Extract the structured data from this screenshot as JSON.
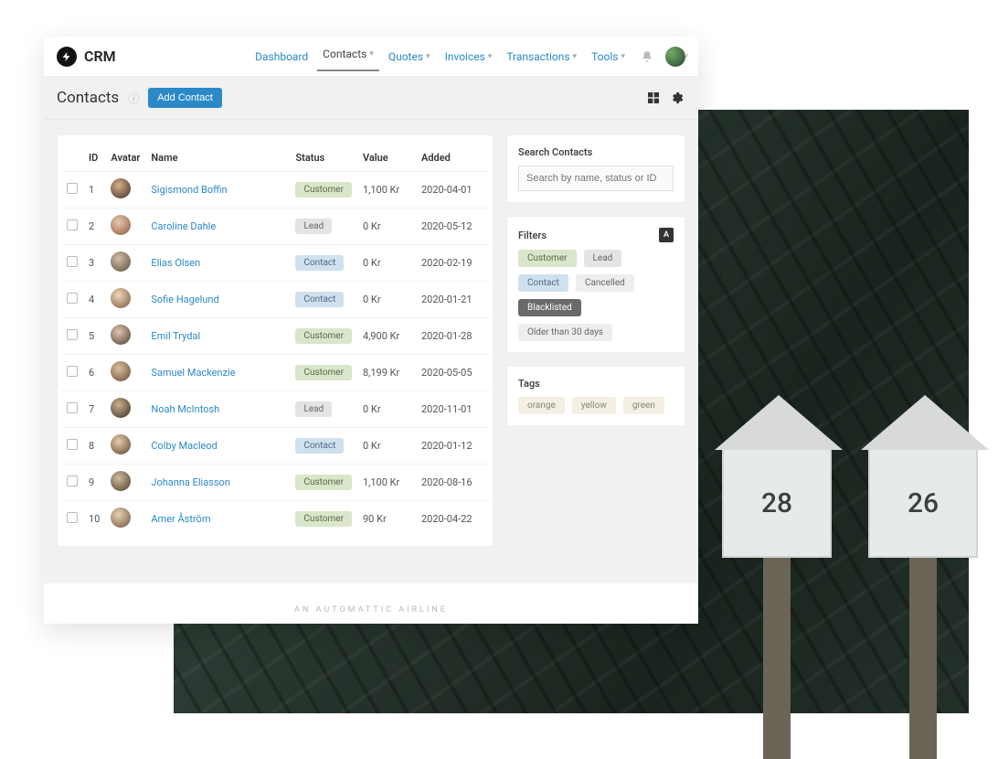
{
  "brand": {
    "name": "CRM"
  },
  "nav": {
    "items": [
      {
        "label": "Dashboard"
      },
      {
        "label": "Contacts",
        "active": true
      },
      {
        "label": "Quotes"
      },
      {
        "label": "Invoices"
      },
      {
        "label": "Transactions"
      },
      {
        "label": "Tools"
      }
    ]
  },
  "page": {
    "title": "Contacts",
    "add_button": "Add Contact"
  },
  "table": {
    "headers": {
      "id": "ID",
      "avatar": "Avatar",
      "name": "Name",
      "status": "Status",
      "value": "Value",
      "added": "Added"
    },
    "rows": [
      {
        "id": "1",
        "name": "Sigismond Boffin",
        "status": "Customer",
        "status_kind": "customer",
        "value": "1,100 Kr",
        "added": "2020-04-01"
      },
      {
        "id": "2",
        "name": "Caroline Dahle",
        "status": "Lead",
        "status_kind": "lead",
        "value": "0 Kr",
        "added": "2020-05-12"
      },
      {
        "id": "3",
        "name": "Elias Olsen",
        "status": "Contact",
        "status_kind": "contact",
        "value": "0 Kr",
        "added": "2020-02-19"
      },
      {
        "id": "4",
        "name": "Sofie Hagelund",
        "status": "Contact",
        "status_kind": "contact",
        "value": "0 Kr",
        "added": "2020-01-21"
      },
      {
        "id": "5",
        "name": "Emil Trydal",
        "status": "Customer",
        "status_kind": "customer",
        "value": "4,900 Kr",
        "added": "2020-01-28"
      },
      {
        "id": "6",
        "name": "Samuel Mackenzie",
        "status": "Customer",
        "status_kind": "customer",
        "value": "8,199 Kr",
        "added": "2020-05-05"
      },
      {
        "id": "7",
        "name": "Noah McIntosh",
        "status": "Lead",
        "status_kind": "lead",
        "value": "0 Kr",
        "added": "2020-11-01"
      },
      {
        "id": "8",
        "name": "Colby Macleod",
        "status": "Contact",
        "status_kind": "contact",
        "value": "0 Kr",
        "added": "2020-01-12"
      },
      {
        "id": "9",
        "name": "Johanna Eliasson",
        "status": "Customer",
        "status_kind": "customer",
        "value": "1,100 Kr",
        "added": "2020-08-16"
      },
      {
        "id": "10",
        "name": "Amer Åström",
        "status": "Customer",
        "status_kind": "customer",
        "value": "90 Kr",
        "added": "2020-04-22"
      }
    ]
  },
  "sidebar": {
    "search": {
      "title": "Search Contacts",
      "placeholder": "Search by name, status or ID"
    },
    "filters": {
      "title": "Filters",
      "chips": {
        "customer": "Customer",
        "lead": "Lead",
        "contact": "Contact",
        "cancelled": "Cancelled",
        "blacklisted": "Blacklisted",
        "older": "Older than 30 days"
      }
    },
    "tags": {
      "title": "Tags",
      "items": {
        "orange": "orange",
        "yellow": "yellow",
        "green": "green"
      }
    }
  },
  "footer": "AN AUTOMATTIC AIRLINE",
  "bg": {
    "mailbox_left": "28",
    "mailbox_right": "26"
  }
}
